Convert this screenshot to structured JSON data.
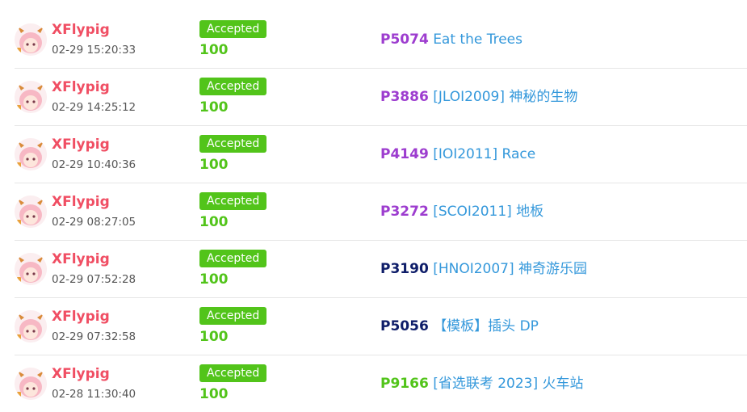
{
  "colors": {
    "username": "#f04e63",
    "accepted_badge": "#52c41a",
    "score": "#52c41a",
    "title_link": "#3498db",
    "difficulty_purple": "#9d3dcf",
    "difficulty_navy": "#0e1d69",
    "difficulty_green": "#52c41a"
  },
  "records": [
    {
      "user": "XFlypig",
      "time": "02-29 15:20:33",
      "status": "Accepted",
      "score": "100",
      "pid": "P5074",
      "title": "Eat the Trees",
      "pid_color": "#9d3dcf"
    },
    {
      "user": "XFlypig",
      "time": "02-29 14:25:12",
      "status": "Accepted",
      "score": "100",
      "pid": "P3886",
      "title": "[JLOI2009] 神秘的生物",
      "pid_color": "#9d3dcf"
    },
    {
      "user": "XFlypig",
      "time": "02-29 10:40:36",
      "status": "Accepted",
      "score": "100",
      "pid": "P4149",
      "title": "[IOI2011] Race",
      "pid_color": "#9d3dcf"
    },
    {
      "user": "XFlypig",
      "time": "02-29 08:27:05",
      "status": "Accepted",
      "score": "100",
      "pid": "P3272",
      "title": "[SCOI2011] 地板",
      "pid_color": "#9d3dcf"
    },
    {
      "user": "XFlypig",
      "time": "02-29 07:52:28",
      "status": "Accepted",
      "score": "100",
      "pid": "P3190",
      "title": "[HNOI2007] 神奇游乐园",
      "pid_color": "#0e1d69"
    },
    {
      "user": "XFlypig",
      "time": "02-29 07:32:58",
      "status": "Accepted",
      "score": "100",
      "pid": "P5056",
      "title": "【模板】插头 DP",
      "pid_color": "#0e1d69"
    },
    {
      "user": "XFlypig",
      "time": "02-28 11:30:40",
      "status": "Accepted",
      "score": "100",
      "pid": "P9166",
      "title": "[省选联考 2023] 火车站",
      "pid_color": "#52c41a"
    }
  ]
}
